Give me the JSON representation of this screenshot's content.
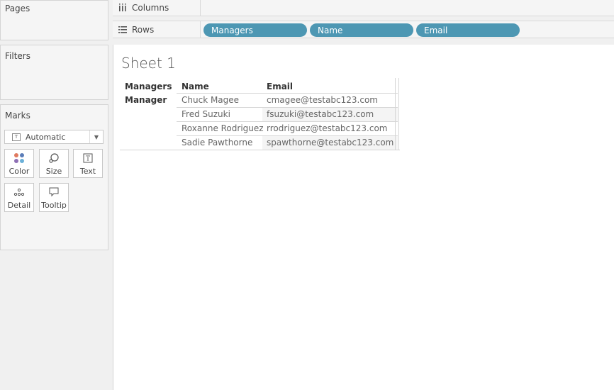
{
  "left_panel": {
    "pages_title": "Pages",
    "filters_title": "Filters",
    "marks_title": "Marks",
    "mark_type": "Automatic",
    "mark_buttons": [
      {
        "label": "Color",
        "icon": "color-dots-icon"
      },
      {
        "label": "Size",
        "icon": "size-icon"
      },
      {
        "label": "Text",
        "icon": "text-icon"
      },
      {
        "label": "Detail",
        "icon": "detail-icon"
      },
      {
        "label": "Tooltip",
        "icon": "tooltip-icon"
      }
    ]
  },
  "shelves": {
    "columns_label": "Columns",
    "rows_label": "Rows",
    "row_pills": [
      "Managers",
      "Name",
      "Email"
    ],
    "pill_color": "#4d97b3"
  },
  "sheet": {
    "title": "Sheet 1",
    "headers": [
      "Managers",
      "Name",
      "Email"
    ],
    "group": "Manager",
    "rows": [
      {
        "name": "Chuck Magee",
        "email": "cmagee@testabc123.com"
      },
      {
        "name": "Fred Suzuki",
        "email": "fsuzuki@testabc123.com"
      },
      {
        "name": "Roxanne Rodriguez",
        "email": "rrodriguez@testabc123.com"
      },
      {
        "name": "Sadie Pawthorne",
        "email": "spawthorne@testabc123.com"
      }
    ]
  }
}
